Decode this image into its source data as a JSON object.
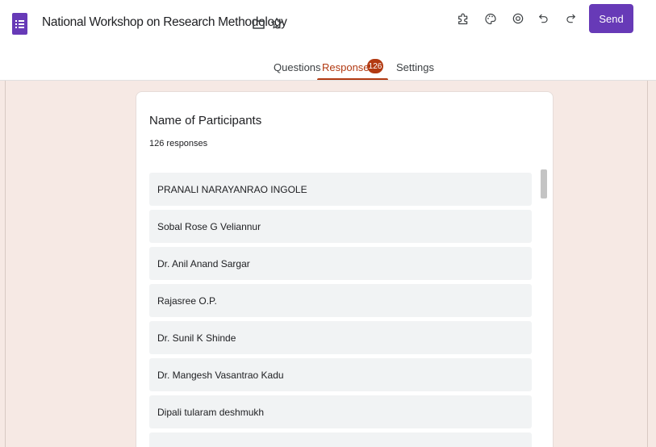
{
  "header": {
    "title": "National Workshop on Research Methodology",
    "icons": {
      "app": "forms-logo-icon",
      "folder": "folder-icon",
      "star": "star-icon",
      "addons": "puzzle-icon",
      "theme": "palette-icon",
      "preview": "eye-icon",
      "undo": "undo-icon",
      "redo": "redo-icon"
    },
    "send_label": "Send"
  },
  "tabs": {
    "questions": "Questions",
    "responses": "Responses",
    "responses_badge": "126",
    "settings": "Settings"
  },
  "colors": {
    "brand": "#673ab7",
    "accent": "#b23a12",
    "page_background": "#f6e9e4",
    "item_background": "#f1f3f4"
  },
  "card": {
    "title": "Name  of Participants",
    "count": "126 responses",
    "responses": [
      "PRANALI NARAYANRAO INGOLE",
      "Sobal Rose G Veliannur",
      "Dr. Anil Anand Sargar",
      "Rajasree O.P.",
      "Dr. Sunil K Shinde",
      "Dr. Mangesh Vasantrao Kadu",
      "Dipali tularam deshmukh"
    ]
  }
}
